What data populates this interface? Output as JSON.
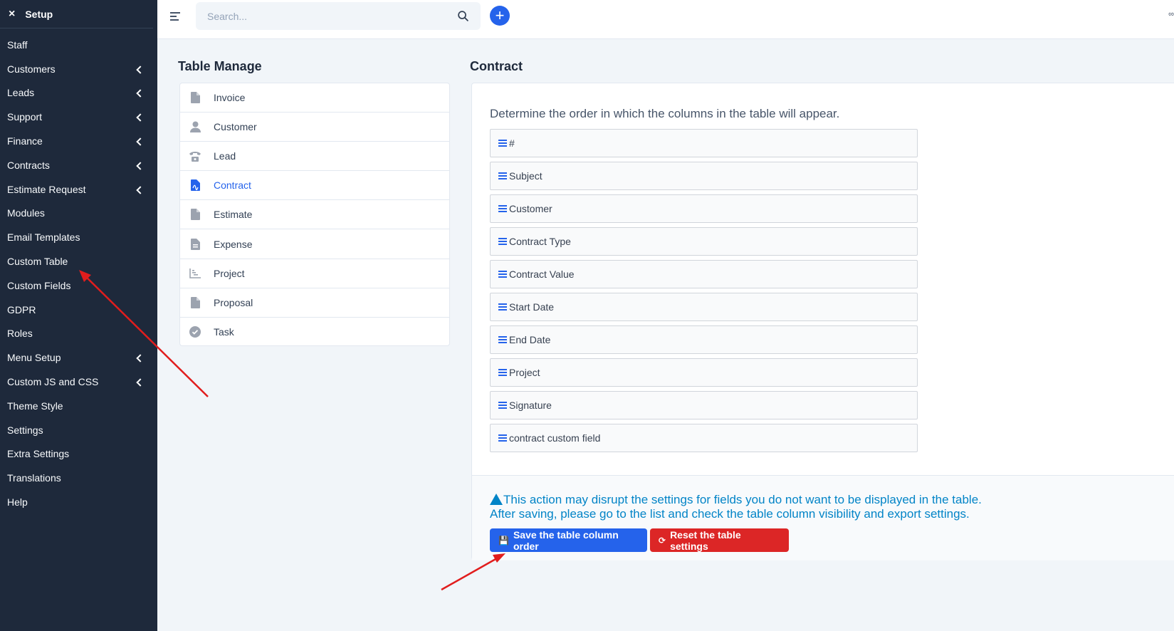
{
  "sidebar": {
    "header": {
      "close_icon": "×",
      "title": "Setup"
    },
    "items": [
      {
        "label": "Staff",
        "expandable": false
      },
      {
        "label": "Customers",
        "expandable": true
      },
      {
        "label": "Leads",
        "expandable": true
      },
      {
        "label": "Support",
        "expandable": true
      },
      {
        "label": "Finance",
        "expandable": true
      },
      {
        "label": "Contracts",
        "expandable": true
      },
      {
        "label": "Estimate Request",
        "expandable": true
      },
      {
        "label": "Modules",
        "expandable": false
      },
      {
        "label": "Email Templates",
        "expandable": false
      },
      {
        "label": "Custom Table",
        "expandable": false
      },
      {
        "label": "Custom Fields",
        "expandable": false
      },
      {
        "label": "GDPR",
        "expandable": false
      },
      {
        "label": "Roles",
        "expandable": false
      },
      {
        "label": "Menu Setup",
        "expandable": true
      },
      {
        "label": "Custom JS and CSS",
        "expandable": true
      },
      {
        "label": "Theme Style",
        "expandable": false
      },
      {
        "label": "Settings",
        "expandable": false
      },
      {
        "label": "Extra Settings",
        "expandable": false
      },
      {
        "label": "Translations",
        "expandable": false
      },
      {
        "label": "Help",
        "expandable": false
      }
    ]
  },
  "topbar": {
    "search_placeholder": "Search...",
    "add_label": "+"
  },
  "table_manage": {
    "title": "Table Manage",
    "items": [
      {
        "label": "Invoice",
        "icon": "file-icon",
        "active": false
      },
      {
        "label": "Customer",
        "icon": "user-icon",
        "active": false
      },
      {
        "label": "Lead",
        "icon": "phone-icon",
        "active": false
      },
      {
        "label": "Contract",
        "icon": "contract-file-icon",
        "active": true
      },
      {
        "label": "Estimate",
        "icon": "file-icon",
        "active": false
      },
      {
        "label": "Expense",
        "icon": "file-lines-icon",
        "active": false
      },
      {
        "label": "Project",
        "icon": "chart-icon",
        "active": false
      },
      {
        "label": "Proposal",
        "icon": "file-icon",
        "active": false
      },
      {
        "label": "Task",
        "icon": "check-circle-icon",
        "active": false
      }
    ]
  },
  "contract": {
    "title": "Contract",
    "description": "Determine the order in which the columns in the table will appear.",
    "columns": [
      "#",
      "Subject",
      "Customer",
      "Contract Type",
      "Contract Value",
      "Start Date",
      "End Date",
      "Project",
      "Signature",
      "contract custom field"
    ],
    "warning_line1": "This action may disrupt the settings for fields you do not want to be displayed in the table.",
    "warning_line2": "After saving, please go to the list and check the table column visibility and export settings.",
    "save_label": "Save the table column order",
    "reset_label": "Reset the table settings"
  },
  "colors": {
    "sidebar_bg": "#1e293b",
    "accent": "#2563eb",
    "danger": "#dc2626",
    "info": "#0284c7",
    "annotation_arrow": "#e11d1d"
  }
}
